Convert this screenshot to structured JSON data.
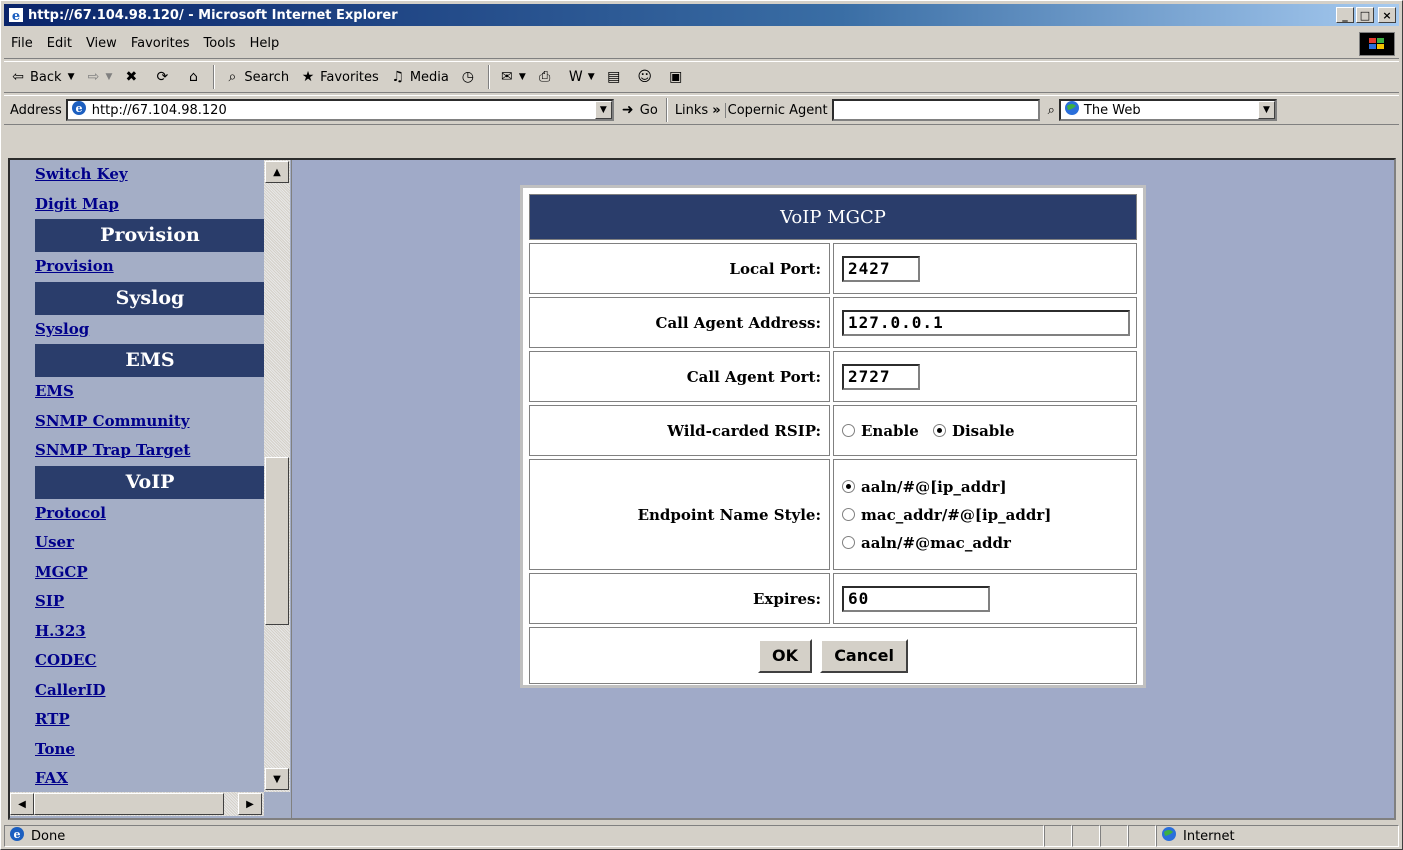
{
  "window": {
    "title": "http://67.104.98.120/ - Microsoft Internet Explorer"
  },
  "menu": [
    {
      "id": "file",
      "label": "File"
    },
    {
      "id": "edit",
      "label": "Edit"
    },
    {
      "id": "view",
      "label": "View"
    },
    {
      "id": "favorites",
      "label": "Favorites"
    },
    {
      "id": "tools",
      "label": "Tools"
    },
    {
      "id": "help",
      "label": "Help"
    }
  ],
  "toolbar": {
    "back": "Back",
    "search": "Search",
    "favorites": "Favorites",
    "media": "Media"
  },
  "address": {
    "label": "Address",
    "url": "http://67.104.98.120",
    "go": "Go",
    "links": "Links",
    "agent_label": "Copernic Agent",
    "agent_value": "",
    "search_scope": "The Web"
  },
  "sidebar": [
    {
      "type": "link",
      "label": "Switch Key"
    },
    {
      "type": "link",
      "label": "Digit Map"
    },
    {
      "type": "header",
      "label": "Provision"
    },
    {
      "type": "link",
      "label": "Provision"
    },
    {
      "type": "header",
      "label": "Syslog"
    },
    {
      "type": "link",
      "label": "Syslog"
    },
    {
      "type": "header",
      "label": "EMS"
    },
    {
      "type": "link",
      "label": "EMS"
    },
    {
      "type": "link",
      "label": "SNMP Community"
    },
    {
      "type": "link",
      "label": "SNMP Trap Target"
    },
    {
      "type": "header",
      "label": "VoIP"
    },
    {
      "type": "link",
      "label": "Protocol"
    },
    {
      "type": "link",
      "label": "User"
    },
    {
      "type": "link",
      "label": "MGCP"
    },
    {
      "type": "link",
      "label": "SIP"
    },
    {
      "type": "link",
      "label": "H.323"
    },
    {
      "type": "link",
      "label": "CODEC"
    },
    {
      "type": "link",
      "label": "CallerID"
    },
    {
      "type": "link",
      "label": "RTP"
    },
    {
      "type": "link",
      "label": "Tone"
    },
    {
      "type": "link",
      "label": "FAX"
    }
  ],
  "form": {
    "title": "VoIP MGCP",
    "local_port": {
      "label": "Local Port:",
      "value": "2427"
    },
    "call_agent_address": {
      "label": "Call Agent Address:",
      "value": "127.0.0.1"
    },
    "call_agent_port": {
      "label": "Call Agent Port:",
      "value": "2727"
    },
    "wildcard_rsip": {
      "label": "Wild-carded RSIP:",
      "enable": "Enable",
      "disable": "Disable",
      "selected": "Disable"
    },
    "endpoint_style": {
      "label": "Endpoint Name Style:",
      "options": [
        "aaln/#@[ip_addr]",
        "mac_addr/#@[ip_addr]",
        "aaln/#@mac_addr"
      ],
      "selected": "aaln/#@[ip_addr]"
    },
    "expires": {
      "label": "Expires:",
      "value": "60"
    },
    "ok": "OK",
    "cancel": "Cancel"
  },
  "status": {
    "text": "Done",
    "zone": "Internet"
  }
}
